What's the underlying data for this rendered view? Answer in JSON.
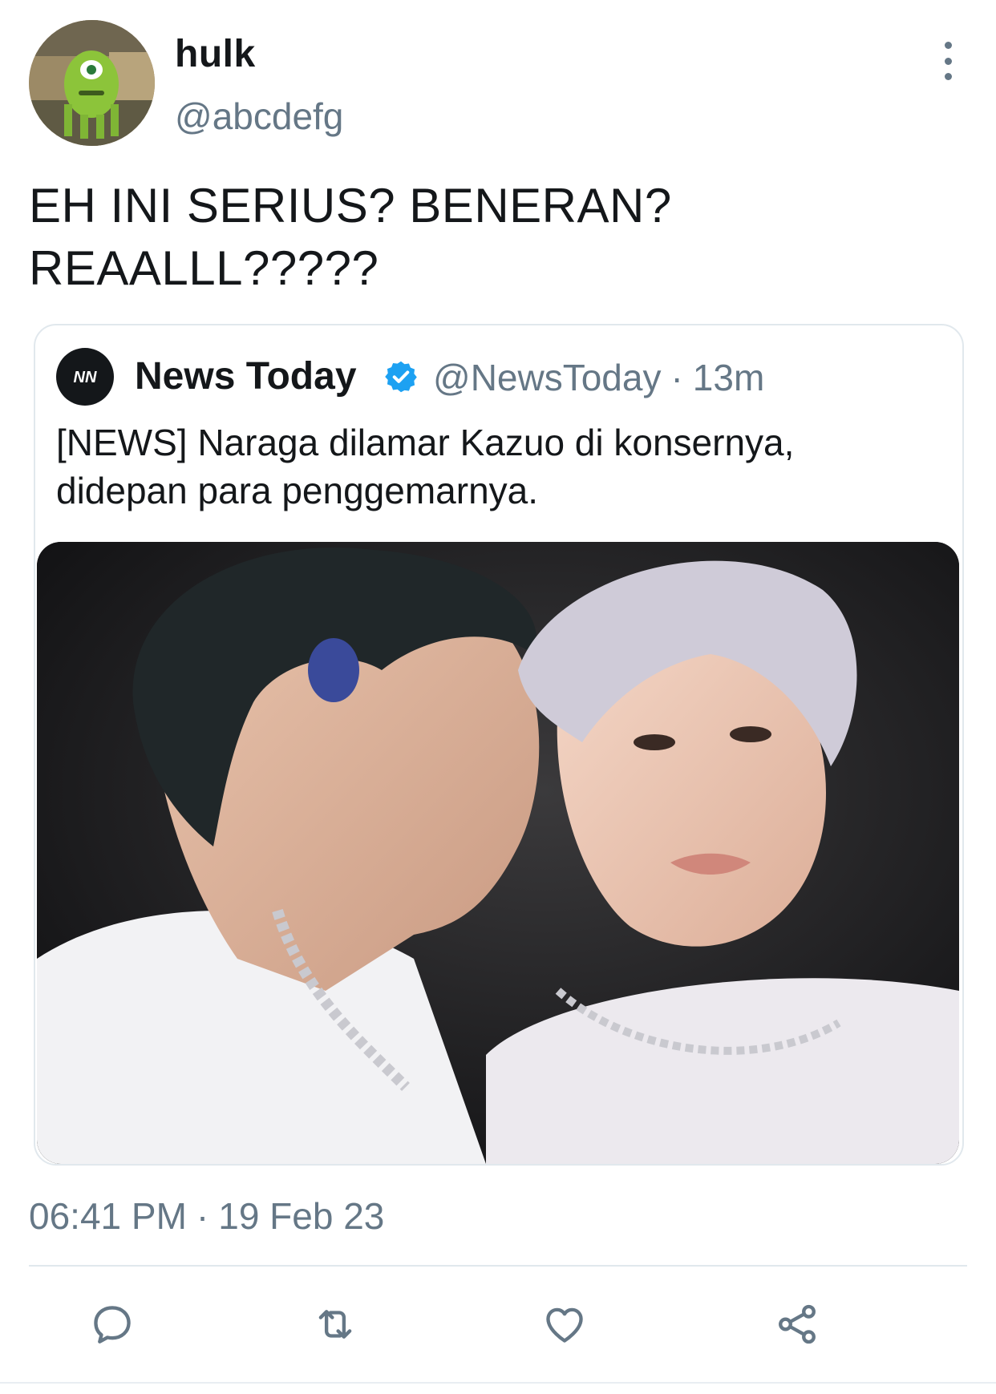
{
  "author": {
    "name": "hulk",
    "handle": "@abcdefg"
  },
  "tweet": {
    "text_line1": "EH INI SERIUS? BENERAN?",
    "text_line2": "REAALLL?????"
  },
  "quoted": {
    "name": "News Today",
    "handle": "@NewsToday",
    "separator": "·",
    "time": "13m",
    "text_line1": "[NEWS] Naraga dilamar Kazuo di konsernya,",
    "text_line2": "didepan para penggemarnya.",
    "logo_text": "NN"
  },
  "meta": {
    "time": "06:41 PM",
    "separator": "·",
    "date": "19 Feb 23"
  },
  "icons": {
    "more": "more-vertical-icon",
    "verified": "verified-badge-icon",
    "reply": "reply-icon",
    "retweet": "retweet-icon",
    "like": "heart-icon",
    "share": "share-icon"
  },
  "colors": {
    "text": "#14171a",
    "muted": "#657786",
    "verified": "#1da1f2",
    "border": "#e1e8ed"
  }
}
